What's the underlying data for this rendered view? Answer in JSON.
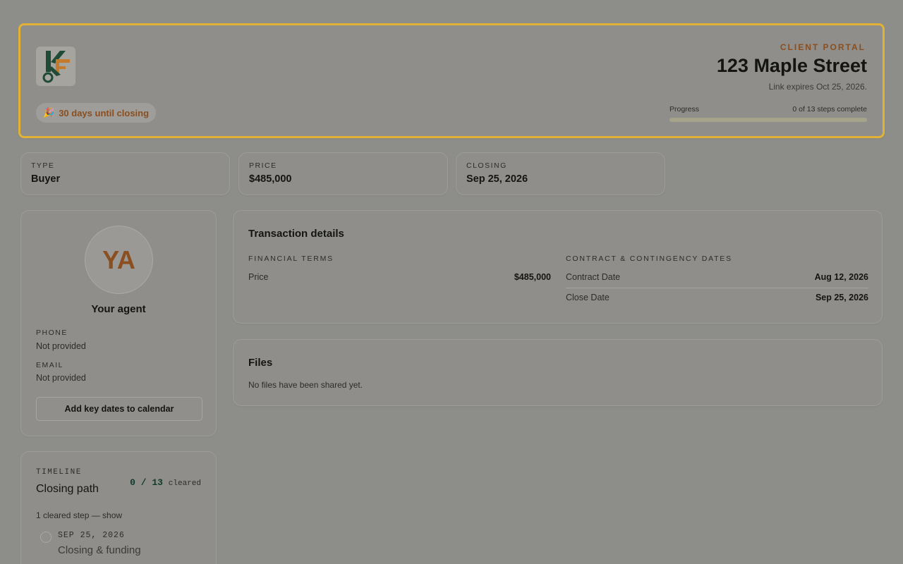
{
  "header": {
    "portal_label": "CLIENT PORTAL",
    "address": "123 Maple Street",
    "expires": "Link expires Oct 25, 2026.",
    "closing_pill": {
      "emoji": "🎉",
      "text": "30 days until closing"
    },
    "progress": {
      "label": "Progress",
      "status": "0 of 13 steps complete",
      "fraction": 0
    },
    "logo": "kf-logo"
  },
  "stats": [
    {
      "label": "TYPE",
      "value": "Buyer"
    },
    {
      "label": "PRICE",
      "value": "$485,000"
    },
    {
      "label": "CLOSING",
      "value": "Sep 25, 2026"
    }
  ],
  "agent": {
    "initials": "YA",
    "title": "Your agent",
    "phone_label": "PHONE",
    "phone_value": "Not provided",
    "email_label": "EMAIL",
    "email_value": "Not provided",
    "calendar_button": "Add key dates to calendar"
  },
  "timeline": {
    "label": "TIMELINE",
    "title": "Closing path",
    "count": "0 / 13",
    "count_suffix": "cleared",
    "toggle": "1 cleared step — show",
    "steps": [
      {
        "date": "SEP 25, 2026",
        "name": "Closing & funding"
      }
    ]
  },
  "transaction": {
    "title": "Transaction details",
    "financial_label": "FINANCIAL TERMS",
    "financial": [
      {
        "key": "Price",
        "value": "$485,000"
      }
    ],
    "dates_label": "CONTRACT & CONTINGENCY DATES",
    "dates": [
      {
        "key": "Contract Date",
        "value": "Aug 12, 2026"
      },
      {
        "key": "Close Date",
        "value": "Sep 25, 2026"
      }
    ]
  },
  "files": {
    "title": "Files",
    "empty": "No files have been shared yet."
  },
  "colors": {
    "highlight_border": "#e2b236",
    "accent": "#8a4e20",
    "timeline_count": "#0f3a2c"
  }
}
